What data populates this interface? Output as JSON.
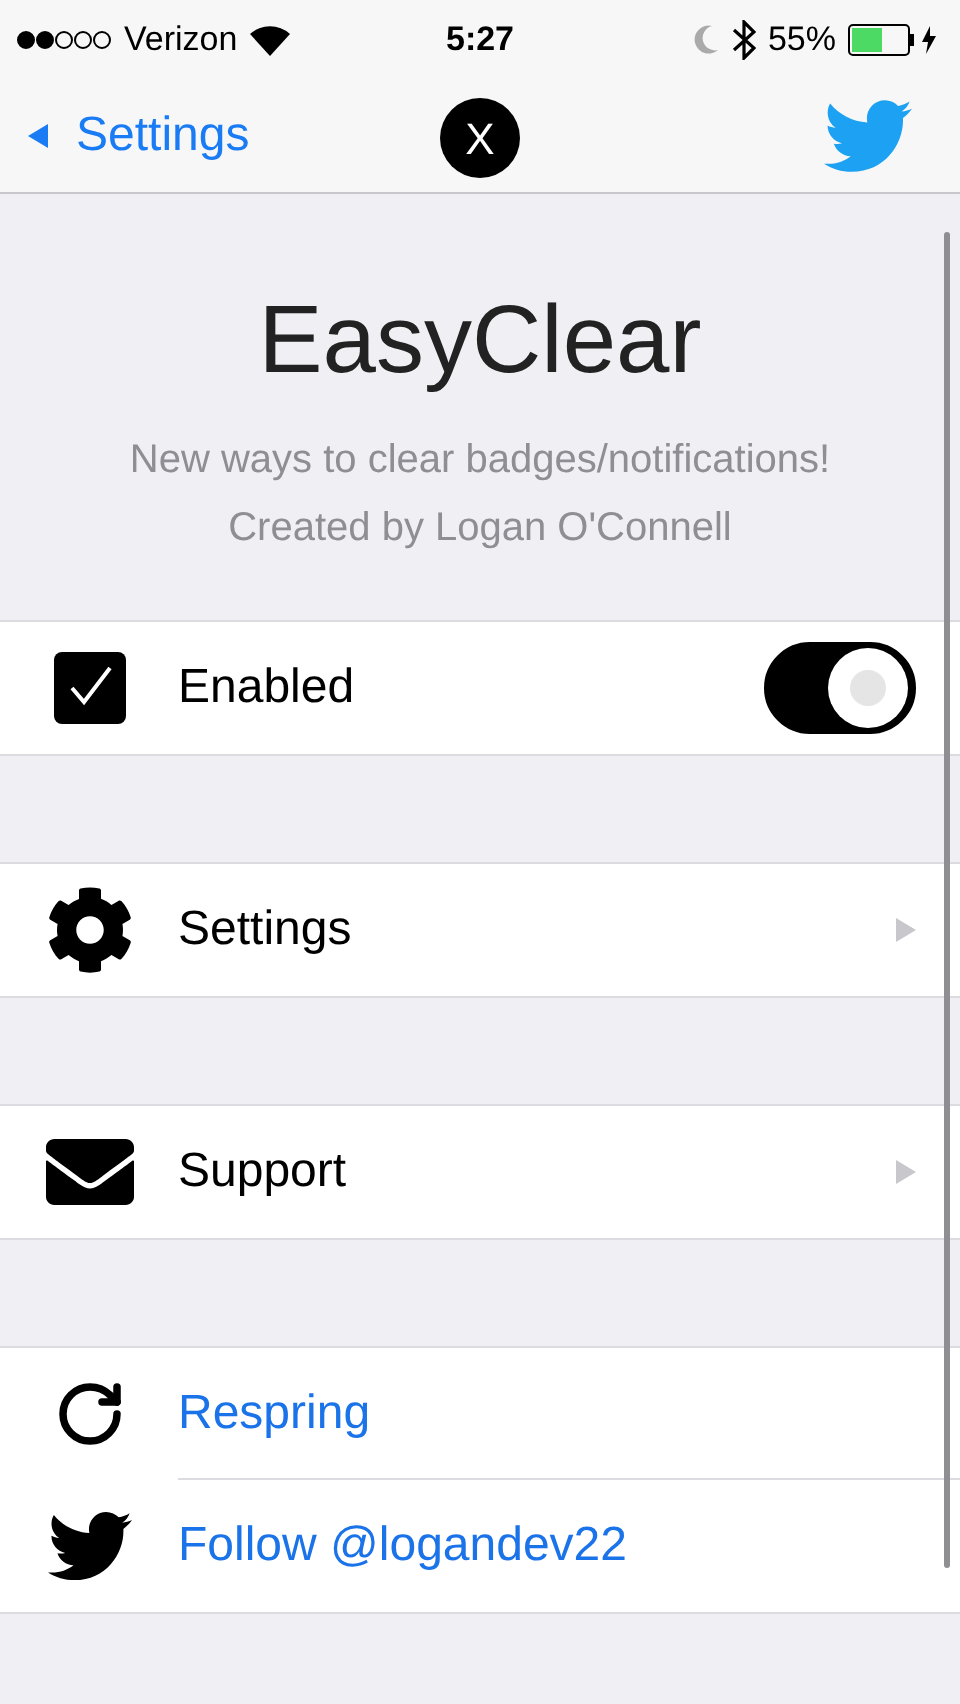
{
  "status_bar": {
    "carrier": "Verizon",
    "time": "5:27",
    "battery": "55%"
  },
  "nav": {
    "back": "Settings",
    "center_badge": "X"
  },
  "header": {
    "title": "EasyClear",
    "subtitle": "New ways to clear badges/notifications!",
    "credit": "Created by Logan O'Connell"
  },
  "sections": [
    {
      "rows": [
        {
          "kind": "toggle",
          "label": "Enabled",
          "on": true
        }
      ]
    },
    {
      "rows": [
        {
          "kind": "link",
          "label": "Settings"
        }
      ]
    },
    {
      "rows": [
        {
          "kind": "link",
          "label": "Support"
        }
      ]
    },
    {
      "rows": [
        {
          "kind": "action",
          "label": "Respring"
        },
        {
          "kind": "action",
          "label": "Follow @logandev22"
        }
      ]
    }
  ]
}
